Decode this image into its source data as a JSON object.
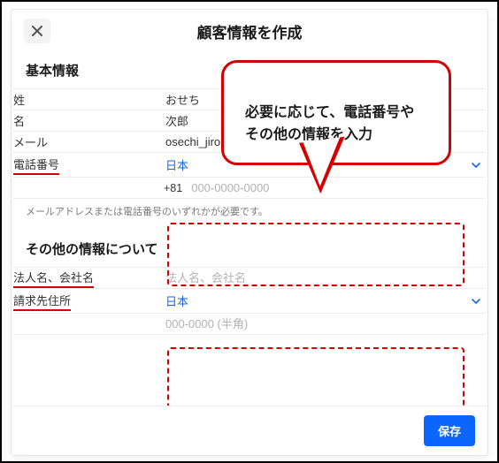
{
  "modal": {
    "title": "顧客情報を作成",
    "save_label": "保存"
  },
  "callout": {
    "text": "必要に応じて、電話番号や\nその他の情報を入力"
  },
  "basic": {
    "section_title": "基本情報",
    "labels": {
      "last_name": "姓",
      "first_name": "名",
      "email": "メール",
      "phone": "電話番号"
    },
    "values": {
      "last_name": "おせち",
      "first_name": "次郎",
      "email": "osechi_jirou@osechi-tec",
      "country": "日本",
      "dial_code": "+81"
    },
    "placeholders": {
      "phone": "000-0000-0000"
    },
    "helper": "メールアドレスまたは電話番号のいずれかが必要です。"
  },
  "other": {
    "section_title": "その他の情報について",
    "labels": {
      "company": "法人名、会社名",
      "billing": "請求先住所"
    },
    "placeholders": {
      "company": "法人名、会社名",
      "zip": "000-0000 (半角)"
    },
    "values": {
      "country": "日本"
    }
  }
}
